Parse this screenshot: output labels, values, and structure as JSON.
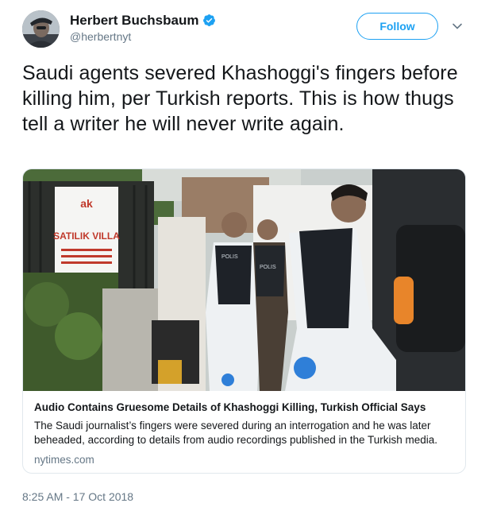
{
  "user": {
    "display_name": "Herbert Buchsbaum",
    "handle": "@herbertnyt",
    "verified": true,
    "avatar_icon": "user-avatar-photo"
  },
  "actions": {
    "follow_label": "Follow",
    "more_icon": "chevron-down-icon"
  },
  "tweet": {
    "text": "Saudi agents severed Khashoggi's fingers before killing him, per Turkish reports. This is how thugs tell a writer he will never write again.",
    "timestamp": "8:25 AM - 17 Oct 2018"
  },
  "card": {
    "title": "Audio Contains Gruesome Details of Khashoggi Killing, Turkish Official Says",
    "description": "The Saudi journalist’s fingers were severed during an interrogation and he was later beheaded, according to details from audio recordings published in the Turkish media.",
    "domain": "nytimes.com",
    "image": {
      "banner_logo": "ak",
      "banner_text": "SATILIK VILLA",
      "vest_text": "POLIS"
    }
  },
  "colors": {
    "accent": "#1da1f2",
    "text": "#14171a",
    "secondary": "#657786",
    "border": "#e1e8ed"
  }
}
